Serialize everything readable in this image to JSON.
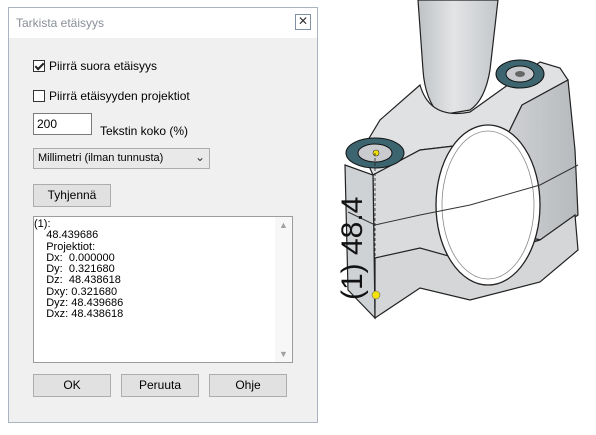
{
  "dialog": {
    "title": "Tarkista etäisyys",
    "close_glyph": "✕",
    "checkbox_direct": {
      "label": "Piirrä suora etäisyys",
      "checked": true
    },
    "checkbox_projection": {
      "label": "Piirrä etäisyyden projektiot",
      "checked": false
    },
    "text_size": {
      "value": "200",
      "label": "Tekstin koko (%)"
    },
    "unit": {
      "selected": "Millimetri (ilman tunnusta)",
      "icon": "chevron-down-icon"
    },
    "clear_button": "Tyhjennä",
    "output": {
      "lines": [
        "(1):",
        "    48.439686",
        "    Projektiot:",
        "    Dx:  0.000000",
        "    Dy:  0.321680",
        "    Dz:  48.438618",
        "    Dxy: 0.321680",
        "    Dyz: 48.439686",
        "    Dxz: 48.438618"
      ]
    },
    "ok_button": "OK",
    "cancel_button": "Peruuta",
    "help_button": "Ohje"
  },
  "viewport": {
    "dimension_label": "(1) 48.4",
    "part_color": "#d4d6d8",
    "marker_color": "#f5e10a"
  }
}
